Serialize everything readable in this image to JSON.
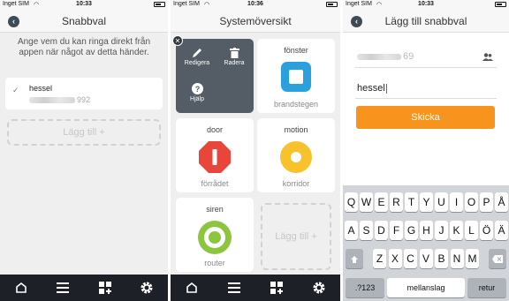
{
  "statusbars": [
    {
      "carrier": "Inget SIM",
      "time": "10:33"
    },
    {
      "carrier": "Inget SIM",
      "time": "10:36"
    },
    {
      "carrier": "Inget SIM",
      "time": "10:33"
    }
  ],
  "screen1": {
    "title": "Snabbval",
    "intro": "Ange vem du kan ringa direkt från appen när något av detta händer.",
    "contact": {
      "name": "hessel",
      "number_suffix": "992"
    },
    "add_label": "Lägg till +"
  },
  "screen2": {
    "title": "Systemöversikt",
    "edit_actions": {
      "edit": "Redigera",
      "delete": "Radera",
      "help": "Hjälp"
    },
    "tiles": [
      {
        "title": "fönster",
        "subtitle": "brandstegen",
        "icon": "window-square-icon",
        "color": "#2aa0dc"
      },
      {
        "title": "door",
        "subtitle": "förrådet",
        "icon": "door-octagon-icon",
        "color": "#e8463a"
      },
      {
        "title": "motion",
        "subtitle": "korridor",
        "icon": "motion-circle-icon",
        "color": "#f7c22c"
      },
      {
        "title": "siren",
        "subtitle": "router",
        "icon": "siren-ring-icon",
        "color": "#8cc63f"
      }
    ],
    "add_label": "Lägg till +"
  },
  "screen3": {
    "title": "Lägg till snabbval",
    "phone_suffix": "69",
    "name_value": "hessel",
    "send_label": "Skicka",
    "keyboard": {
      "row1": [
        "Q",
        "W",
        "E",
        "R",
        "T",
        "Y",
        "U",
        "I",
        "O",
        "P",
        "Å"
      ],
      "row2": [
        "A",
        "S",
        "D",
        "F",
        "G",
        "H",
        "J",
        "K",
        "L",
        "Ö",
        "Ä"
      ],
      "row3": [
        "Z",
        "X",
        "C",
        "V",
        "B",
        "N",
        "M"
      ],
      "numbers_key": ".?123",
      "space_key": "mellanslag",
      "return_key": "retur"
    }
  },
  "colors": {
    "tabbar": "#1d2127",
    "accent_orange": "#f7941d"
  }
}
